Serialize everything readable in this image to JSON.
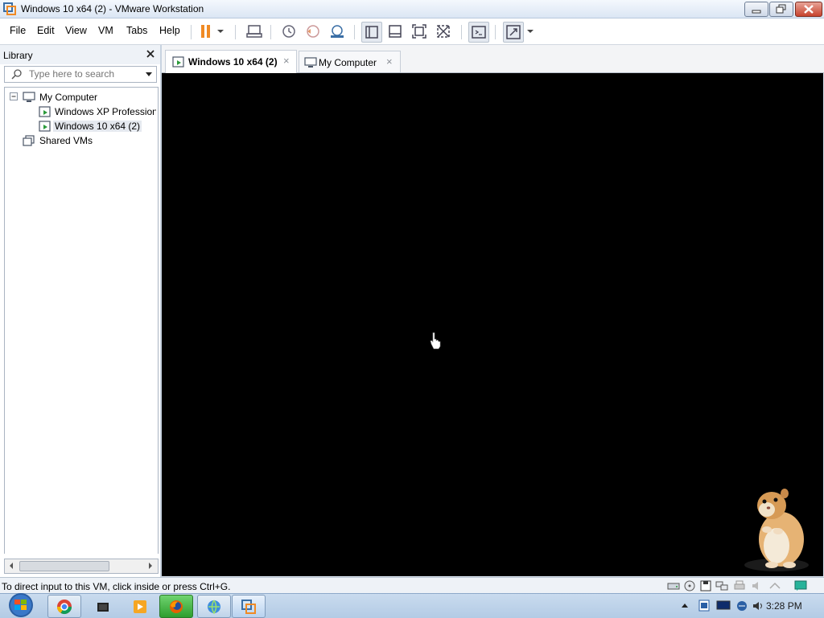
{
  "window": {
    "title": "Windows 10 x64 (2) - VMware Workstation"
  },
  "menu": [
    "File",
    "Edit",
    "View",
    "VM",
    "Tabs",
    "Help"
  ],
  "toolbar": {
    "icons": [
      "pause-icon",
      "dropdown-arrow-icon",
      "send-ctrl-alt-del-icon",
      "snapshot-icon",
      "revert-snapshot-icon",
      "snapshot-manager-icon",
      "show-library-icon",
      "thumbnail-bar-icon",
      "full-screen-icon",
      "unity-icon",
      "console-view-icon",
      "stretch-icon",
      "dropdown-arrow-icon"
    ],
    "pause_color": "#f08a24"
  },
  "library": {
    "title": "Library",
    "search_placeholder": "Type here to search",
    "tree": [
      {
        "label": "My Computer",
        "level": 0,
        "expanded": true
      },
      {
        "label": "Windows XP Professional",
        "level": 1
      },
      {
        "label": "Windows 10 x64 (2)",
        "level": 1,
        "selected": true
      },
      {
        "label": "Shared VMs",
        "level": 0
      }
    ]
  },
  "tabs": [
    {
      "label": "Windows 10 x64 (2)",
      "active": true,
      "close": "×"
    },
    {
      "label": "My Computer",
      "active": false,
      "close": "×"
    }
  ],
  "vm": {
    "screen_color": "#000000"
  },
  "status": {
    "text": "To direct input to this VM, click inside or press Ctrl+G.",
    "icons": [
      "hard-disk-icon",
      "cd-drive-icon",
      "floppy-icon",
      "network-icon",
      "printer-icon",
      "sound-icon",
      "usb-icon",
      "message-icon"
    ]
  },
  "taskbar": {
    "buttons": [
      "chrome-icon",
      "vmware-player-icon",
      "media-player-icon",
      "firefox-icon",
      "network-globe-icon",
      "vmware-workstation-icon"
    ],
    "clock": "3:28 PM",
    "tray": [
      "show-hidden-icons-arrow",
      "flag-icon",
      "monitor-icon",
      "network-status-icon",
      "volume-icon"
    ]
  }
}
